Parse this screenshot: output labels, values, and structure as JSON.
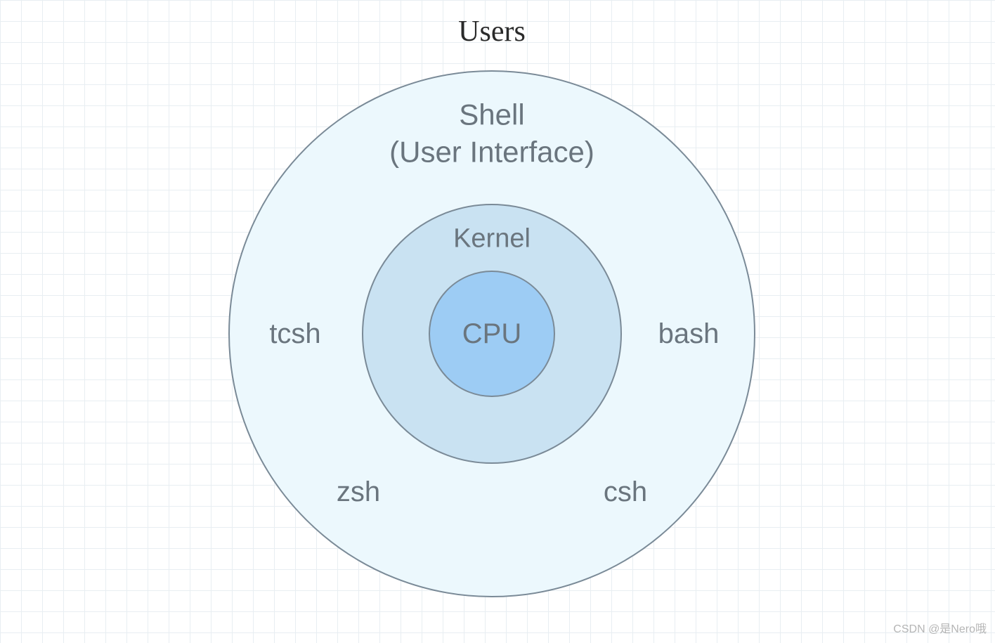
{
  "title": "Users",
  "rings": {
    "shell": {
      "line1": "Shell",
      "line2": "(User Interface)"
    },
    "kernel": "Kernel",
    "cpu": "CPU"
  },
  "shells": {
    "tcsh": "tcsh",
    "bash": "bash",
    "zsh": "zsh",
    "csh": "csh"
  },
  "watermark": "CSDN @是Nero哦",
  "colors": {
    "grid_line": "#e8eef2",
    "ring_border": "#7a8a97",
    "shell_fill": "#ecf8fd",
    "kernel_fill": "#c9e2f2",
    "cpu_fill": "#9dccf4",
    "label_text": "#6a757e",
    "title_text": "#2a2a2a"
  }
}
